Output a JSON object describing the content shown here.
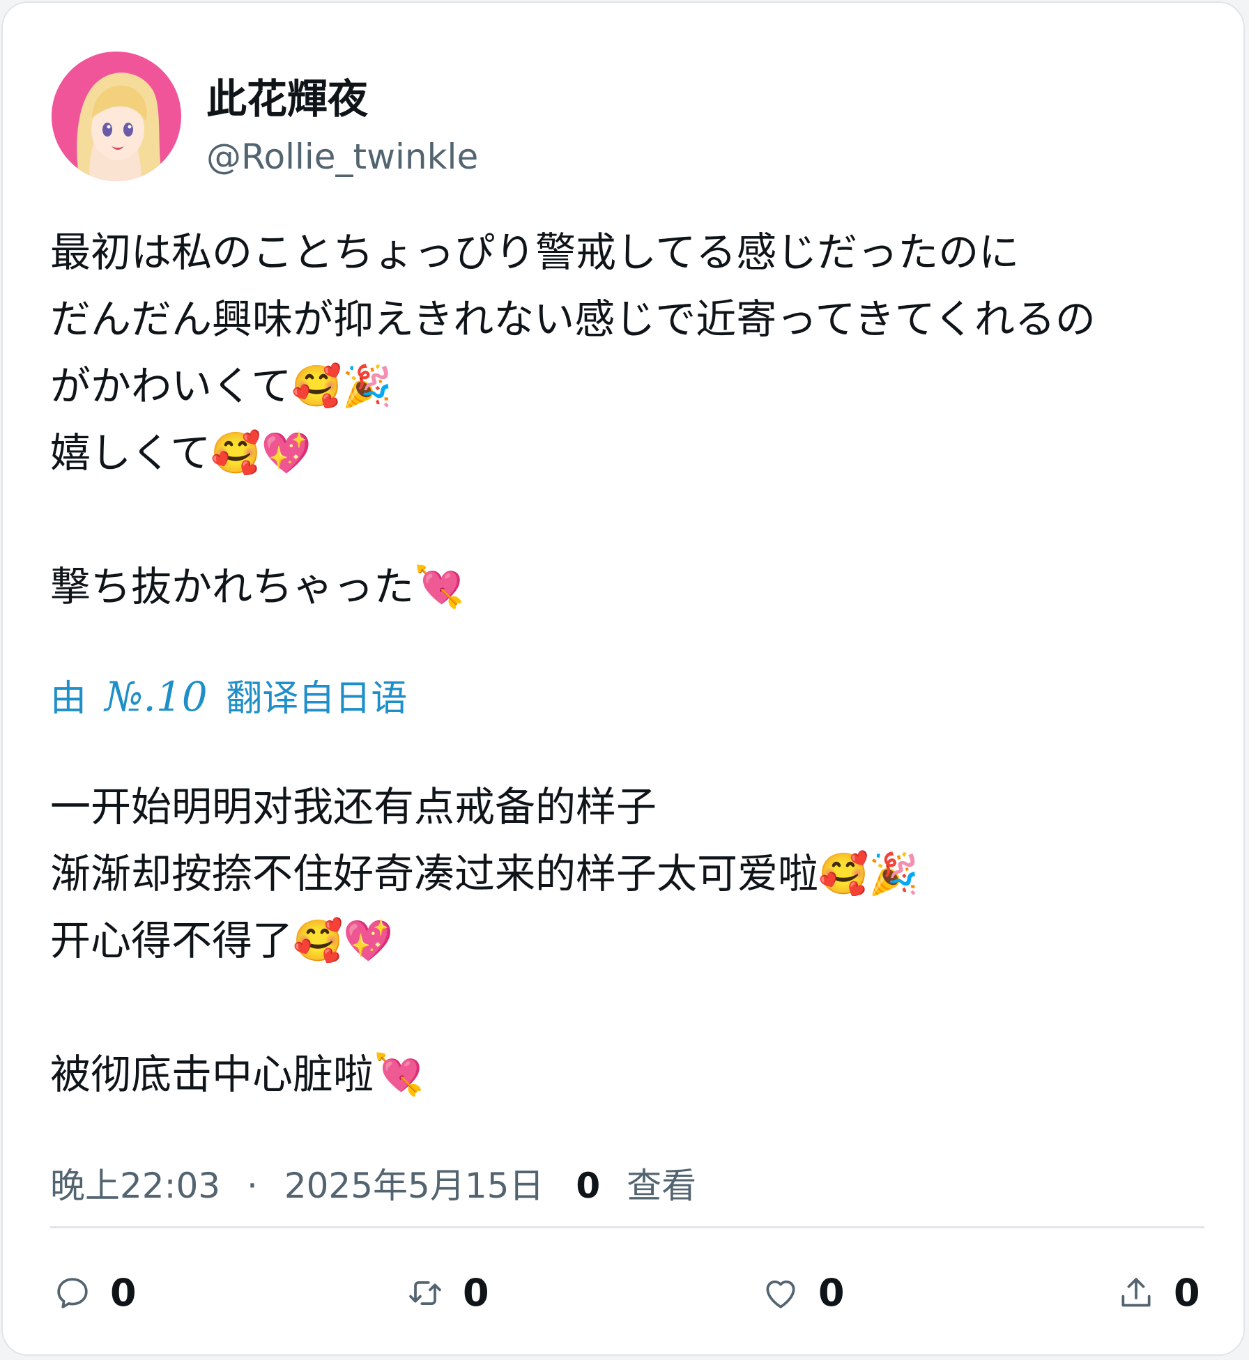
{
  "author": {
    "display_name": "此花輝夜",
    "handle": "@Rollie_twinkle",
    "avatar_icon": "anime-girl-avatar"
  },
  "tweet": {
    "original_lines": [
      "最初は私のことちょっぴり警戒してる感じだったのに",
      "だんだん興味が抑えきれない感じで近寄ってきてくれるの",
      "がかわいくて🥰🎉",
      "嬉しくて🥰💖",
      "",
      "撃ち抜かれちゃった💘"
    ],
    "translation_prefix": "由",
    "translation_brand": "№.10",
    "translation_suffix": "翻译自日语",
    "translated_lines": [
      "一开始明明对我还有点戒备的样子",
      "渐渐却按捺不住好奇凑过来的样子太可爱啦🥰🎉",
      "开心得不得了🥰💖",
      "",
      "被彻底击中心脏啦💘"
    ]
  },
  "meta": {
    "time": "晚上22:03",
    "separator": "·",
    "date": "2025年5月15日",
    "views_count": "0",
    "views_label": "查看"
  },
  "actions": {
    "reply_count": "0",
    "retweet_count": "0",
    "like_count": "0",
    "share_count": "0"
  },
  "colors": {
    "link": "#1f8fc9",
    "secondary_text": "#536471",
    "avatar_bg": "#f0559a"
  }
}
